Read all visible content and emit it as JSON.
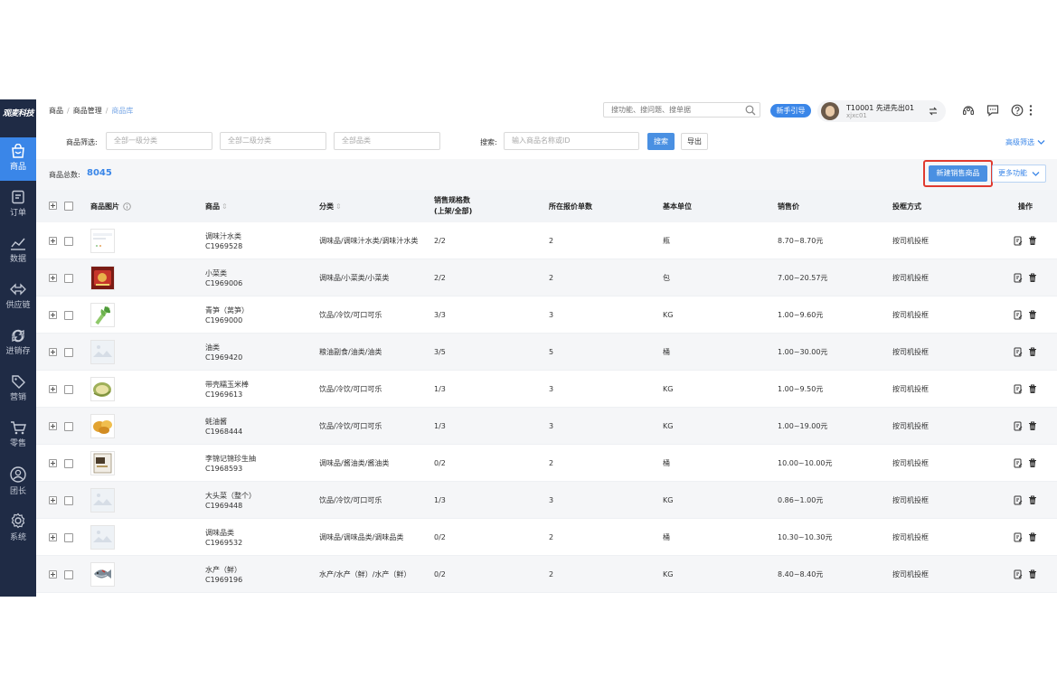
{
  "sidebar": {
    "logo": "观麦科技",
    "items": [
      {
        "label": "商品",
        "icon": "shopping-bag-icon",
        "active": true
      },
      {
        "label": "订单",
        "icon": "order-doc-icon"
      },
      {
        "label": "数据",
        "icon": "line-chart-icon"
      },
      {
        "label": "供应链",
        "icon": "supply-chain-icon"
      },
      {
        "label": "进销存",
        "icon": "inventory-icon"
      },
      {
        "label": "营销",
        "icon": "tag-icon"
      },
      {
        "label": "零售",
        "icon": "cart-icon"
      },
      {
        "label": "团长",
        "icon": "user-icon"
      },
      {
        "label": "系统",
        "icon": "gear-icon"
      }
    ]
  },
  "header": {
    "breadcrumb": [
      "商品",
      "商品管理",
      "商品库"
    ],
    "search_placeholder": "搜功能、搜问题、搜单据",
    "guide_label": "新手引导",
    "user_name": "T10001 先进先出01",
    "user_id": "xjxc01"
  },
  "filters": {
    "category_label": "商品筛选:",
    "level1_placeholder": "全部一级分类",
    "level2_placeholder": "全部二级分类",
    "product_category_placeholder": "全部品类",
    "search_label": "搜索:",
    "search_placeholder": "输入商品名称或ID",
    "search_button": "搜索",
    "export_button": "导出",
    "advanced_label": "高级筛选"
  },
  "summary": {
    "total_label": "商品总数:",
    "total_value": "8045",
    "new_button": "新建销售商品",
    "more_button": "更多功能"
  },
  "table": {
    "headers": {
      "image": "商品图片",
      "product": "商品",
      "category": "分类",
      "spec_line1": "销售规格数",
      "spec_line2": "(上架/全部)",
      "quote_count": "所在报价单数",
      "unit": "基本单位",
      "price": "销售价",
      "basket": "投框方式",
      "ops": "操作"
    },
    "rows": [
      {
        "name": "调味汁水类",
        "code": "C1969528",
        "category": "调味品/调味汁水类/调味汁水类",
        "spec": "2/2",
        "quotes": "2",
        "unit": "瓶",
        "price": "8.70~8.70元",
        "basket": "按司机投框",
        "img": "placeholder-doc"
      },
      {
        "name": "小菜类",
        "code": "C1969006",
        "category": "调味品/小菜类/小菜类",
        "spec": "2/2",
        "quotes": "2",
        "unit": "包",
        "price": "7.00~20.57元",
        "basket": "按司机投框",
        "img": "snack-pack"
      },
      {
        "name": "青笋（莴笋）",
        "code": "C1969000",
        "category": "饮品/冷饮/可口可乐",
        "spec": "3/3",
        "quotes": "3",
        "unit": "KG",
        "price": "1.00~9.60元",
        "basket": "按司机投框",
        "img": "lettuce"
      },
      {
        "name": "油类",
        "code": "C1969420",
        "category": "粮油副食/油类/油类",
        "spec": "3/5",
        "quotes": "5",
        "unit": "桶",
        "price": "1.00~30.00元",
        "basket": "按司机投框",
        "img": "placeholder"
      },
      {
        "name": "带壳糯玉米棒",
        "code": "C1969613",
        "category": "饮品/冷饮/可口可乐",
        "spec": "1/3",
        "quotes": "3",
        "unit": "KG",
        "price": "1.00~9.50元",
        "basket": "按司机投框",
        "img": "corn"
      },
      {
        "name": "蚝油酱",
        "code": "C1968444",
        "category": "饮品/冷饮/可口可乐",
        "spec": "1/3",
        "quotes": "3",
        "unit": "KG",
        "price": "1.00~19.00元",
        "basket": "按司机投框",
        "img": "sauce"
      },
      {
        "name": "李锦记锦珍生抽",
        "code": "C1968593",
        "category": "调味品/酱油类/酱油类",
        "spec": "0/2",
        "quotes": "2",
        "unit": "桶",
        "price": "10.00~10.00元",
        "basket": "按司机投框",
        "img": "box"
      },
      {
        "name": "大头菜（整个）",
        "code": "C1969448",
        "category": "饮品/冷饮/可口可乐",
        "spec": "1/3",
        "quotes": "3",
        "unit": "KG",
        "price": "0.86~1.00元",
        "basket": "按司机投框",
        "img": "placeholder"
      },
      {
        "name": "调味品类",
        "code": "C1969532",
        "category": "调味品/调味品类/调味品类",
        "spec": "0/2",
        "quotes": "2",
        "unit": "桶",
        "price": "10.30~10.30元",
        "basket": "按司机投框",
        "img": "placeholder"
      },
      {
        "name": "水产（鲜）",
        "code": "C1969196",
        "category": "水产/水产（鲜）/水产（鲜）",
        "spec": "0/2",
        "quotes": "2",
        "unit": "KG",
        "price": "8.40~8.40元",
        "basket": "按司机投框",
        "img": "fish"
      }
    ]
  },
  "colors": {
    "sidebar_bg": "#1f2b45",
    "accent": "#3a86e8",
    "highlight_border": "#e03a2f"
  }
}
